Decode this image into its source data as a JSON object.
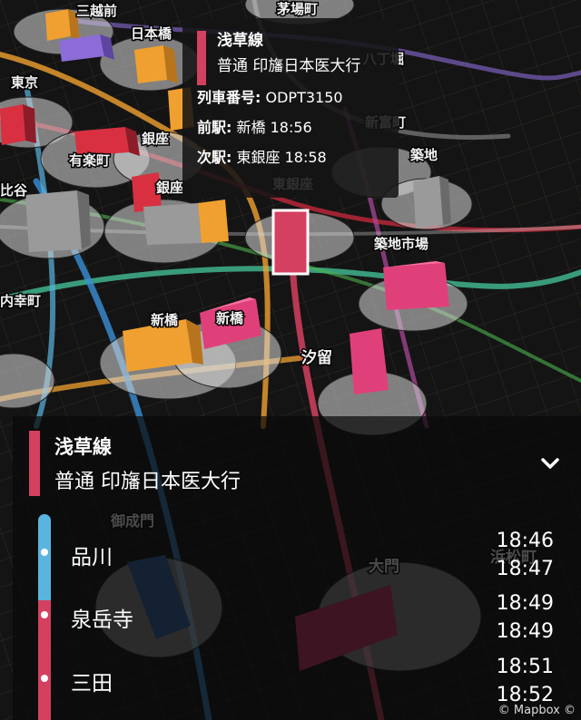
{
  "map": {
    "background": "#141414",
    "labels": [
      {
        "id": "mitsukoshimae",
        "text": "三越前"
      },
      {
        "id": "kayabacho",
        "text": "茅場町"
      },
      {
        "id": "nihombashi",
        "text": "日本橋"
      },
      {
        "id": "tokyo",
        "text": "東京"
      },
      {
        "id": "hatchobori",
        "text": "八丁堀"
      },
      {
        "id": "shintomicho",
        "text": "新富町"
      },
      {
        "id": "ginza1",
        "text": "銀座"
      },
      {
        "id": "ginza2",
        "text": "銀座"
      },
      {
        "id": "yurakucho",
        "text": "有楽町"
      },
      {
        "id": "tsukiji",
        "text": "築地"
      },
      {
        "id": "higashiginza",
        "text": "東銀座"
      },
      {
        "id": "hibiya",
        "text": "比谷"
      },
      {
        "id": "tsukijishijo",
        "text": "築地市場"
      },
      {
        "id": "uchisaiwaicho",
        "text": "内幸町"
      },
      {
        "id": "shimbashi1",
        "text": "新橋"
      },
      {
        "id": "shimbashi2",
        "text": "新橋"
      },
      {
        "id": "shiodome",
        "text": "汐留"
      },
      {
        "id": "onarimon",
        "text": "御成門"
      },
      {
        "id": "daimon",
        "text": "大門"
      },
      {
        "id": "hamamatsucho",
        "text": "浜松町"
      }
    ]
  },
  "tooltip": {
    "line_name": "浅草線",
    "line_color": "#d4405f",
    "destination": "普通 印旛日本医大行",
    "rows": [
      {
        "key": "列車番号:",
        "value": "ODPT3150"
      },
      {
        "key": "前駅:",
        "value": "新橋 18:56"
      },
      {
        "key": "次駅:",
        "value": "東銀座 18:58"
      }
    ]
  },
  "panel": {
    "line_name": "浅草線",
    "line_color": "#d4405f",
    "destination": "普通 印旛日本医大行",
    "expand_icon": "chevron-down-icon",
    "stops": [
      {
        "name": "品川",
        "arrive": "18:46",
        "depart": "18:47",
        "segment_color": "#5ab4e0"
      },
      {
        "name": "泉岳寺",
        "arrive": "18:49",
        "depart": "18:49",
        "segment_color": "#d4405f"
      },
      {
        "name": "三田",
        "arrive": "18:51",
        "depart": "18:52",
        "segment_color": "#d4405f"
      }
    ]
  },
  "attribution": "© Mapbox ©"
}
